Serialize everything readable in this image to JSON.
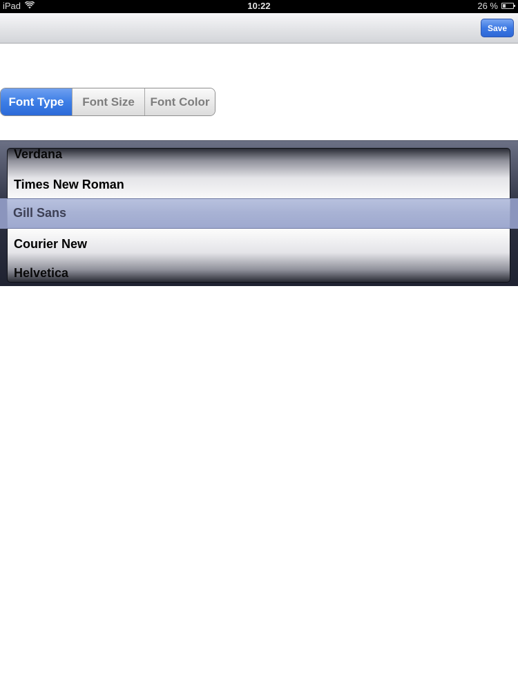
{
  "status_bar": {
    "device": "iPad",
    "time": "10:22",
    "battery_percent": "26 %",
    "battery_level": 0.26
  },
  "toolbar": {
    "save_label": "Save"
  },
  "segmented_control": {
    "segments": [
      {
        "label": "Font Type",
        "selected": true
      },
      {
        "label": "Font Size",
        "selected": false
      },
      {
        "label": "Font Color",
        "selected": false
      }
    ]
  },
  "picker": {
    "items": [
      "Verdana",
      "Times New Roman",
      "Gill Sans",
      "Courier New",
      "Helvetica"
    ],
    "selected": "Gill Sans"
  },
  "colors": {
    "accent": "#3d7ee6",
    "selection_band": "#a5b0d6"
  },
  "icons": {
    "wifi": "wifi-icon",
    "battery": "battery-icon"
  }
}
